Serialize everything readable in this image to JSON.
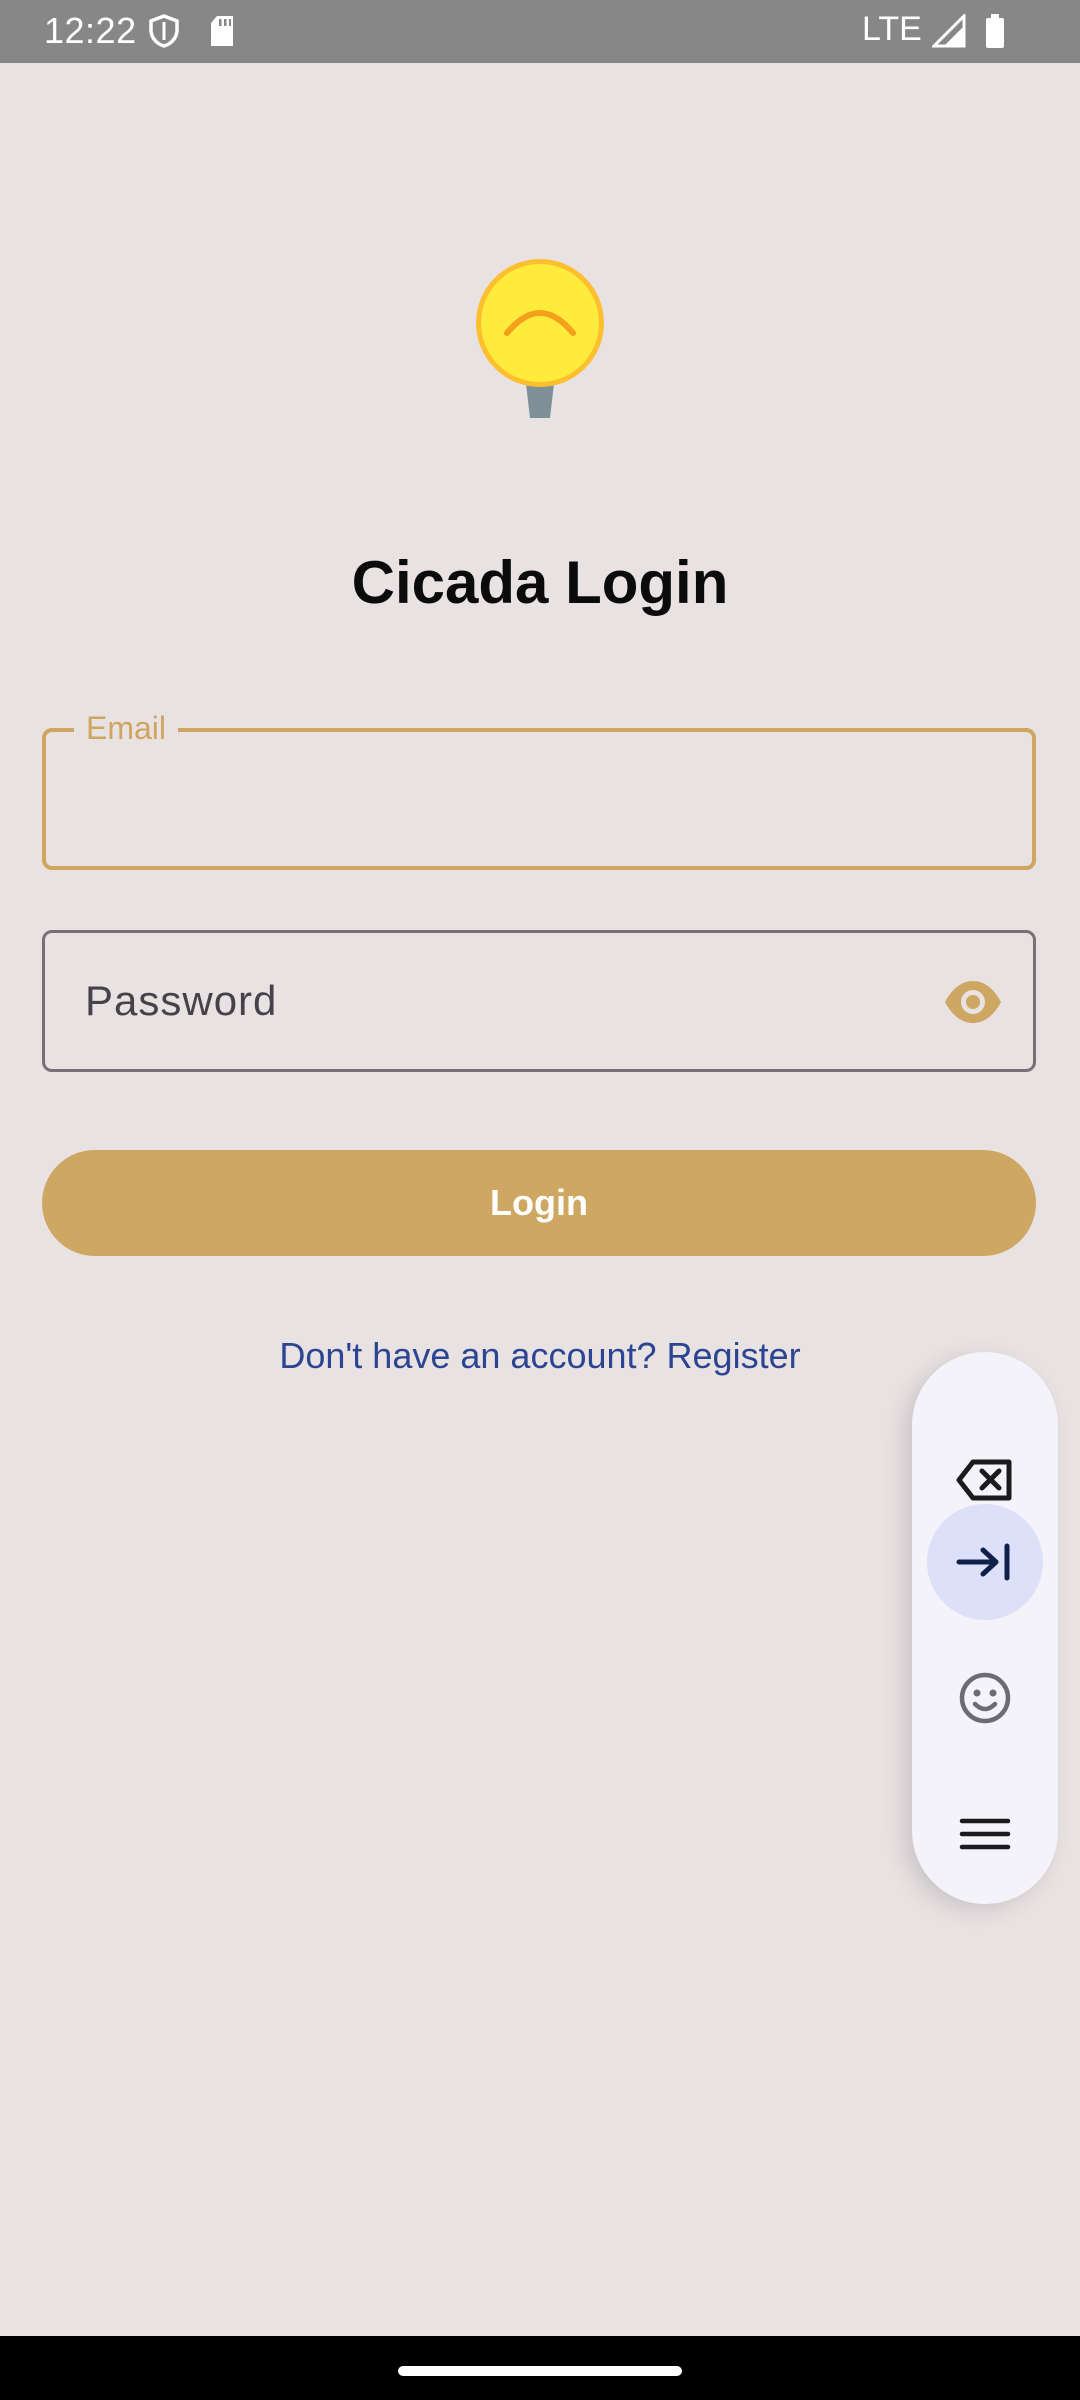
{
  "status_bar": {
    "time": "12:22",
    "network": "LTE",
    "icons": [
      "shield-icon",
      "sd-card-icon",
      "signal-icon",
      "battery-icon"
    ]
  },
  "login": {
    "logo_icon": "lightbulb-logo",
    "title": "Cicada Login",
    "email_label": "Email",
    "email_value": "",
    "password_placeholder": "Password",
    "password_toggle_icon": "eye-icon",
    "login_button": "Login",
    "register_link": "Don't have an account? Register"
  },
  "keyboard_toolbar": {
    "items": [
      "backspace-icon",
      "tab-icon",
      "emoji-icon",
      "menu-icon"
    ]
  },
  "colors": {
    "background": "#e8e2e3",
    "accent": "#cea762",
    "link": "#2b4592",
    "status_bar": "#878787"
  }
}
